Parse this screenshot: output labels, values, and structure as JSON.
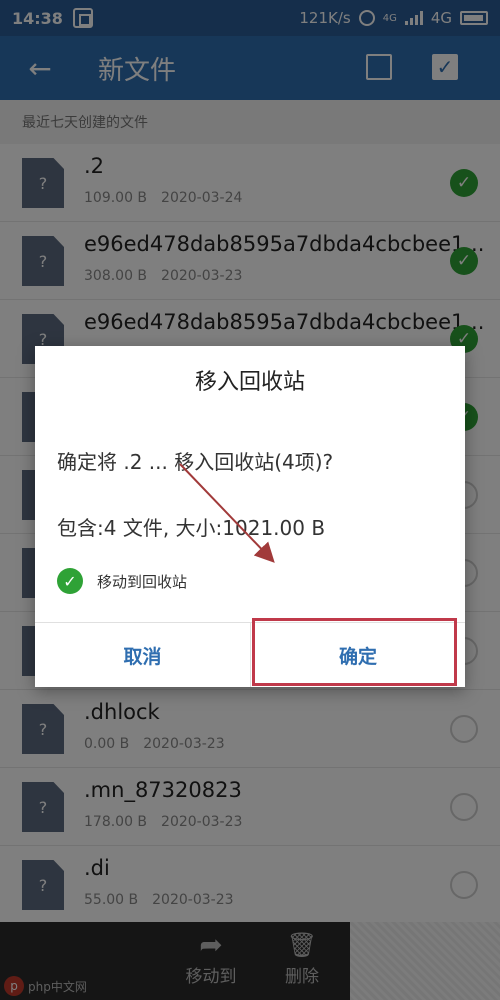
{
  "status_bar": {
    "time": "14:38",
    "speed": "121K/s",
    "net1": "4G",
    "net2": "4G"
  },
  "app_bar": {
    "title": "新文件",
    "back_icon": "arrow-left-icon"
  },
  "section_header": "最近七天创建的文件",
  "files": [
    {
      "name": ".2",
      "size": "109.00 B",
      "date": "2020-03-24",
      "checked": true
    },
    {
      "name": "e96ed478dab8595a7dbda4cbcbee1...",
      "size": "308.00 B",
      "date": "2020-03-23",
      "checked": true
    },
    {
      "name": "e96ed478dab8595a7dbda4cbcbee1...",
      "size": "",
      "date": "",
      "checked": true
    },
    {
      "name": "",
      "size": "",
      "date": "",
      "checked": true
    },
    {
      "name": "",
      "size": "",
      "date": "",
      "checked": false
    },
    {
      "name": "",
      "size": "",
      "date": "",
      "checked": false
    },
    {
      "name": "",
      "size": "",
      "date": "",
      "checked": false
    },
    {
      "name": ".dhlock",
      "size": "0.00 B",
      "date": "2020-03-23",
      "checked": false
    },
    {
      "name": ".mn_87320823",
      "size": "178.00 B",
      "date": "2020-03-23",
      "checked": false
    },
    {
      "name": ".di",
      "size": "55.00 B",
      "date": "2020-03-23",
      "checked": false
    }
  ],
  "file_icon_glyph": "?",
  "dialog": {
    "title": "移入回收站",
    "message": "确定将 .2 ... 移入回收站(4项)?",
    "contains": "包含:4 文件, 大小:1021.00 B",
    "option_label": "移动到回收站",
    "cancel_label": "取消",
    "ok_label": "确定"
  },
  "bottom_bar": {
    "move_label": "移动到",
    "delete_label": "删除"
  },
  "watermark": "php中文网",
  "colors": {
    "status_bar": "#2a5d96",
    "app_bar": "#2f6eb0",
    "check": "#2fa236",
    "highlight": "#c0394a"
  }
}
